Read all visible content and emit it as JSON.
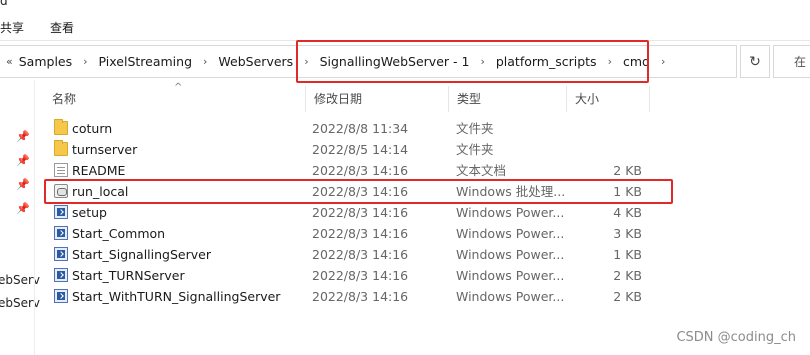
{
  "window_stub": "d",
  "ribbon": {
    "tabs": [
      "共享",
      "查看"
    ]
  },
  "address_bar": {
    "chevrons": "«",
    "crumbs": [
      "Samples",
      "PixelStreaming",
      "WebServers",
      "SignallingWebServer - 1",
      "platform_scripts",
      "cmd"
    ],
    "refresh_icon": "refresh-icon",
    "search_label": "在"
  },
  "left_nav": {
    "pins": [
      "pin-icon",
      "pin-icon",
      "pin-icon",
      "pin-icon"
    ],
    "truncated_items": [
      "ebServ",
      "ebServ"
    ]
  },
  "columns": {
    "name": "名称",
    "date": "修改日期",
    "type": "类型",
    "size": "大小"
  },
  "files": [
    {
      "name": "coturn",
      "date": "2022/8/8 11:34",
      "type": "文件夹",
      "size": "",
      "icon": "folder-icon"
    },
    {
      "name": "turnserver",
      "date": "2022/8/5 14:14",
      "type": "文件夹",
      "size": "",
      "icon": "folder-icon"
    },
    {
      "name": "README",
      "date": "2022/8/3 14:16",
      "type": "文本文档",
      "size": "2 KB",
      "icon": "text-file-icon"
    },
    {
      "name": "run_local",
      "date": "2022/8/3 14:16",
      "type": "Windows 批处理...",
      "size": "1 KB",
      "icon": "batch-file-icon"
    },
    {
      "name": "setup",
      "date": "2022/8/3 14:16",
      "type": "Windows Power...",
      "size": "4 KB",
      "icon": "powershell-file-icon"
    },
    {
      "name": "Start_Common",
      "date": "2022/8/3 14:16",
      "type": "Windows Power...",
      "size": "3 KB",
      "icon": "powershell-file-icon"
    },
    {
      "name": "Start_SignallingServer",
      "date": "2022/8/3 14:16",
      "type": "Windows Power...",
      "size": "1 KB",
      "icon": "powershell-file-icon"
    },
    {
      "name": "Start_TURNServer",
      "date": "2022/8/3 14:16",
      "type": "Windows Power...",
      "size": "2 KB",
      "icon": "powershell-file-icon"
    },
    {
      "name": "Start_WithTURN_SignallingServer",
      "date": "2022/8/3 14:16",
      "type": "Windows Power...",
      "size": "2 KB",
      "icon": "powershell-file-icon"
    }
  ],
  "watermark": "CSDN @coding_ch",
  "colors": {
    "highlight": "#e02a2a",
    "folder": "#f5c84c"
  }
}
